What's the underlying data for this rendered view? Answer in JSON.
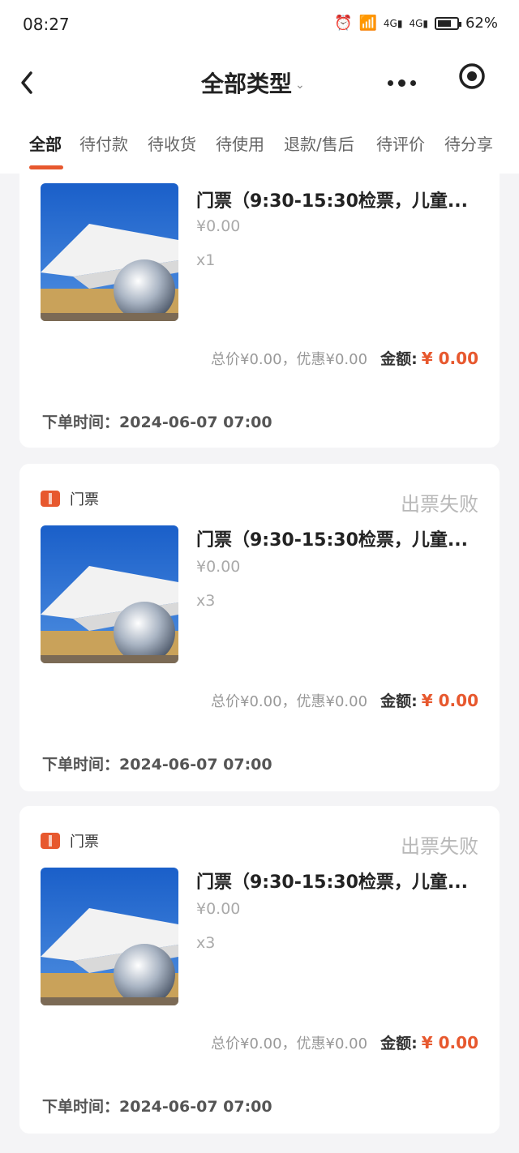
{
  "statusbar": {
    "time": "08:27",
    "battery": "62%",
    "net1": "4G",
    "net2": "4G"
  },
  "nav": {
    "title": "全部类型"
  },
  "tabs": [
    "全部",
    "待付款",
    "待收货",
    "待使用",
    "退款/售后",
    "待评价",
    "待分享"
  ],
  "orders": [
    {
      "shop": "",
      "status": "",
      "title": "门票（9:30-15:30检票，儿童...",
      "price": "¥0.00",
      "qty": "x1",
      "summary_note": "总价¥0.00，优惠¥0.00",
      "amount_label": "金额:",
      "amount": "¥ 0.00",
      "order_time": "下单时间：2024-06-07 07:00"
    },
    {
      "shop": "门票",
      "status": "出票失败",
      "title": "门票（9:30-15:30检票，儿童...",
      "price": "¥0.00",
      "qty": "x3",
      "summary_note": "总价¥0.00，优惠¥0.00",
      "amount_label": "金额:",
      "amount": "¥ 0.00",
      "order_time": "下单时间：2024-06-07 07:00"
    },
    {
      "shop": "门票",
      "status": "出票失败",
      "title": "门票（9:30-15:30检票，儿童...",
      "price": "¥0.00",
      "qty": "x3",
      "summary_note": "总价¥0.00，优惠¥0.00",
      "amount_label": "金额:",
      "amount": "¥ 0.00",
      "order_time": "下单时间：2024-06-07 07:00"
    }
  ],
  "colors": {
    "accent": "#e7582e",
    "muted": "#b8b8b8"
  }
}
